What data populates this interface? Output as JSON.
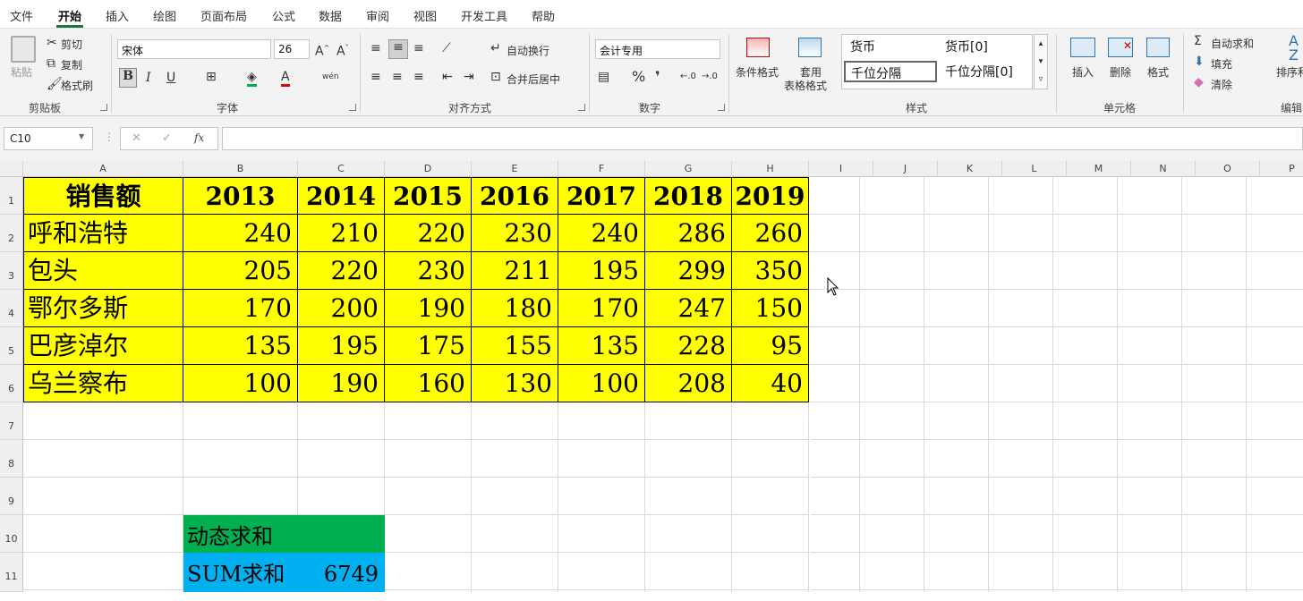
{
  "menu": {
    "tabs": [
      "文件",
      "开始",
      "插入",
      "绘图",
      "页面布局",
      "公式",
      "数据",
      "审阅",
      "视图",
      "开发工具",
      "帮助"
    ],
    "active": "开始"
  },
  "ribbon": {
    "clipboard": {
      "paste": "粘贴",
      "cut": "剪切",
      "copy": "复制",
      "format_painter": "格式刷",
      "label": "剪贴板"
    },
    "font": {
      "name": "宋体",
      "size": "26",
      "bold": "B",
      "italic": "I",
      "underline": "U",
      "label": "字体",
      "grow": "A^",
      "shrink": "A˅",
      "phonetic": "wén"
    },
    "alignment": {
      "wrap": "自动换行",
      "merge": "合并后居中",
      "label": "对齐方式"
    },
    "number": {
      "format": "会计专用",
      "percent": "%",
      "comma": "❜",
      "label": "数字"
    },
    "styles": {
      "conditional": "条件格式",
      "table_line1": "套用",
      "table_line2": "表格格式",
      "label": "样式",
      "gallery": [
        "货币",
        "货币[0]",
        "千位分隔",
        "千位分隔[0]"
      ]
    },
    "cells": {
      "insert": "插入",
      "delete": "删除",
      "format": "格式",
      "label": "单元格"
    },
    "editing": {
      "autosum": "自动求和",
      "fill": "填充",
      "clear": "清除",
      "sort": "排序和",
      "label": "编辑"
    },
    "colors": {
      "accent": "#217346",
      "ribbon_bg": "#f3f3f3"
    }
  },
  "formula_bar": {
    "name_box": "C10",
    "fx": "fx",
    "cancel": "✕",
    "confirm": "✓",
    "value": ""
  },
  "grid": {
    "columns": [
      "A",
      "B",
      "C",
      "D",
      "E",
      "F",
      "G",
      "H",
      "I",
      "J",
      "K",
      "L",
      "M",
      "N",
      "O",
      "P"
    ],
    "rows": [
      "1",
      "2",
      "3",
      "4",
      "5",
      "6",
      "7",
      "8",
      "9",
      "10",
      "11"
    ]
  },
  "table": {
    "header": [
      "销售额",
      "2013",
      "2014",
      "2015",
      "2016",
      "2017",
      "2018",
      "2019"
    ],
    "rows": [
      {
        "city": "呼和浩特",
        "values": [
          "240",
          "210",
          "220",
          "230",
          "240",
          "286",
          "260"
        ]
      },
      {
        "city": "包头",
        "values": [
          "205",
          "220",
          "230",
          "211",
          "195",
          "299",
          "350"
        ]
      },
      {
        "city": "鄂尔多斯",
        "values": [
          "170",
          "200",
          "190",
          "180",
          "170",
          "247",
          "150"
        ]
      },
      {
        "city": "巴彦淖尔",
        "values": [
          "135",
          "195",
          "175",
          "155",
          "135",
          "228",
          "95"
        ]
      },
      {
        "city": "乌兰察布",
        "values": [
          "100",
          "190",
          "160",
          "130",
          "100",
          "208",
          "40"
        ]
      }
    ],
    "fill": "#ffff00"
  },
  "summary": {
    "dynamic_label": "动态求和",
    "dynamic_fill": "#00b050",
    "sum_label": "SUM求和",
    "sum_value": "6749",
    "sum_fill": "#00b0f0"
  }
}
